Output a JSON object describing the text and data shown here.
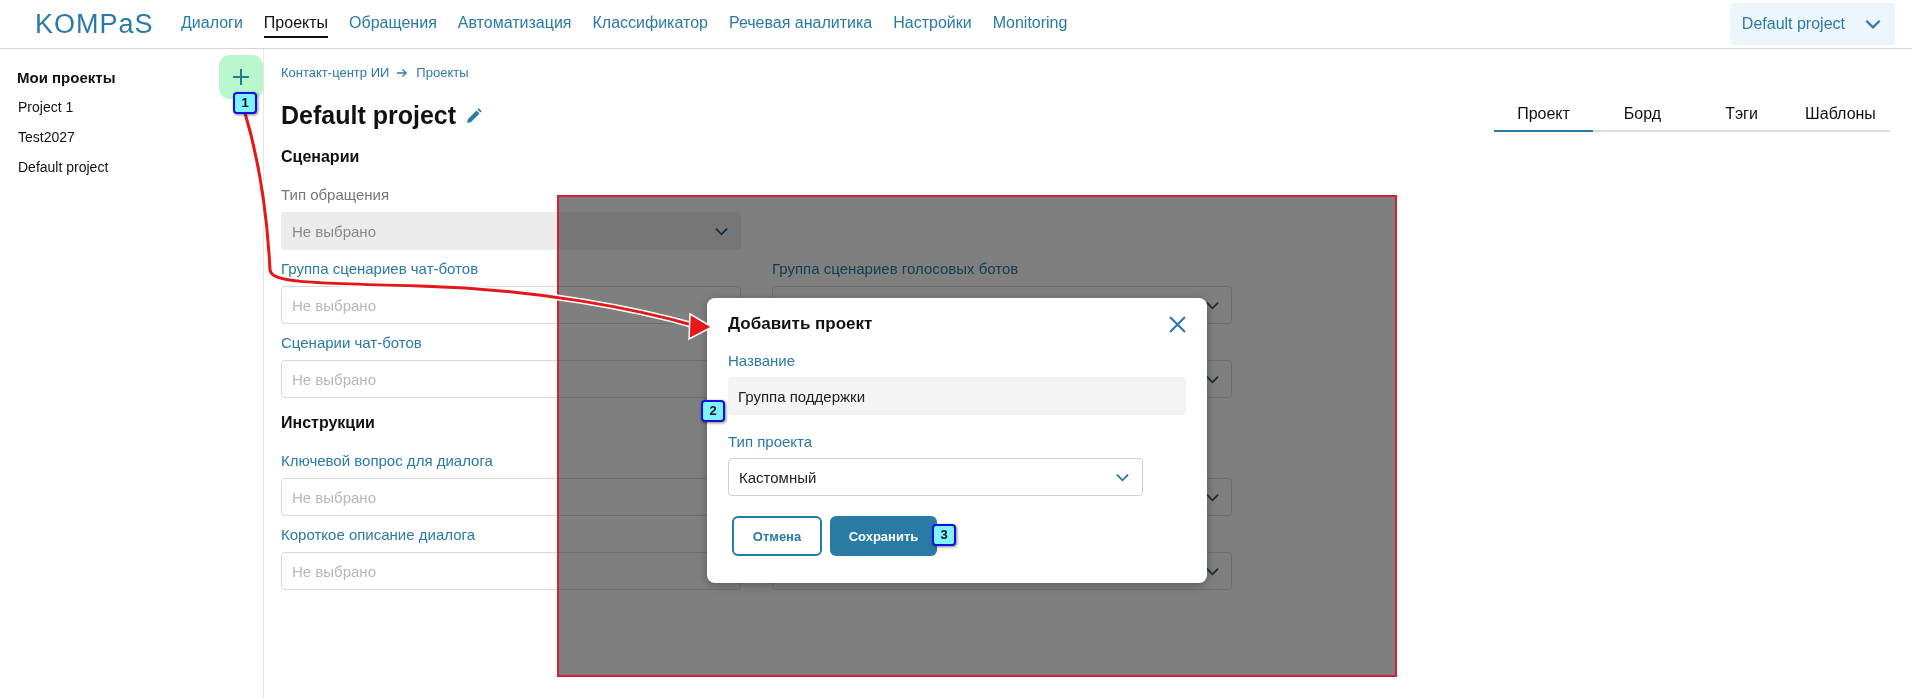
{
  "header": {
    "logo": "KOMPaS",
    "nav": [
      {
        "label": "Диалоги",
        "selected": false
      },
      {
        "label": "Проекты",
        "selected": true
      },
      {
        "label": "Обращения",
        "selected": false
      },
      {
        "label": "Автоматизация",
        "selected": false
      },
      {
        "label": "Классификатор",
        "selected": false
      },
      {
        "label": "Речевая аналитика",
        "selected": false
      },
      {
        "label": "Настройки",
        "selected": false
      },
      {
        "label": "Monitoring",
        "selected": false
      }
    ],
    "project_selector": {
      "value": "Default project"
    }
  },
  "sidebar": {
    "title": "Мои проекты",
    "items": [
      "Project 1",
      "Test2027",
      "Default project"
    ]
  },
  "breadcrumb": [
    "Контакт-центр ИИ",
    "Проекты"
  ],
  "page": {
    "title": "Default project",
    "tabs": [
      {
        "label": "Проект",
        "selected": true
      },
      {
        "label": "Борд",
        "selected": false
      },
      {
        "label": "Тэги",
        "selected": false
      },
      {
        "label": "Шаблоны",
        "selected": false
      }
    ],
    "sections": [
      {
        "title": "Сценарии",
        "rows": [
          [
            {
              "label": "Тип обращения",
              "placeholder": "Не выбрано",
              "disabled": true
            }
          ],
          [
            {
              "label": "Группа сценариев чат-ботов",
              "placeholder": "Не выбрано",
              "disabled": false
            },
            {
              "label": "Группа сценариев голосовых ботов"
            }
          ],
          [
            {
              "label": "Сценарии чат-ботов",
              "placeholder": "Не выбрано",
              "disabled": false
            },
            {}
          ]
        ]
      },
      {
        "title": "Инструкции",
        "rows": [
          [
            {
              "label": "Ключевой вопрос для диалога",
              "placeholder": "Не выбрано",
              "disabled": false
            },
            {}
          ],
          [
            {
              "label": "Короткое описание диалога",
              "placeholder": "Не выбрано",
              "disabled": false
            },
            {}
          ]
        ]
      }
    ]
  },
  "dialog": {
    "title": "Добавить проект",
    "fields": [
      {
        "label": "Название",
        "value": "Группа поддержки",
        "kind": "text"
      },
      {
        "label": "Тип проекта",
        "value": "Кастомный",
        "kind": "select"
      }
    ],
    "buttons": [
      {
        "label": "Отмена",
        "kind": "secondary"
      },
      {
        "label": "Сохранить",
        "kind": "primary"
      }
    ]
  },
  "callouts": [
    "1",
    "2",
    "3"
  ]
}
